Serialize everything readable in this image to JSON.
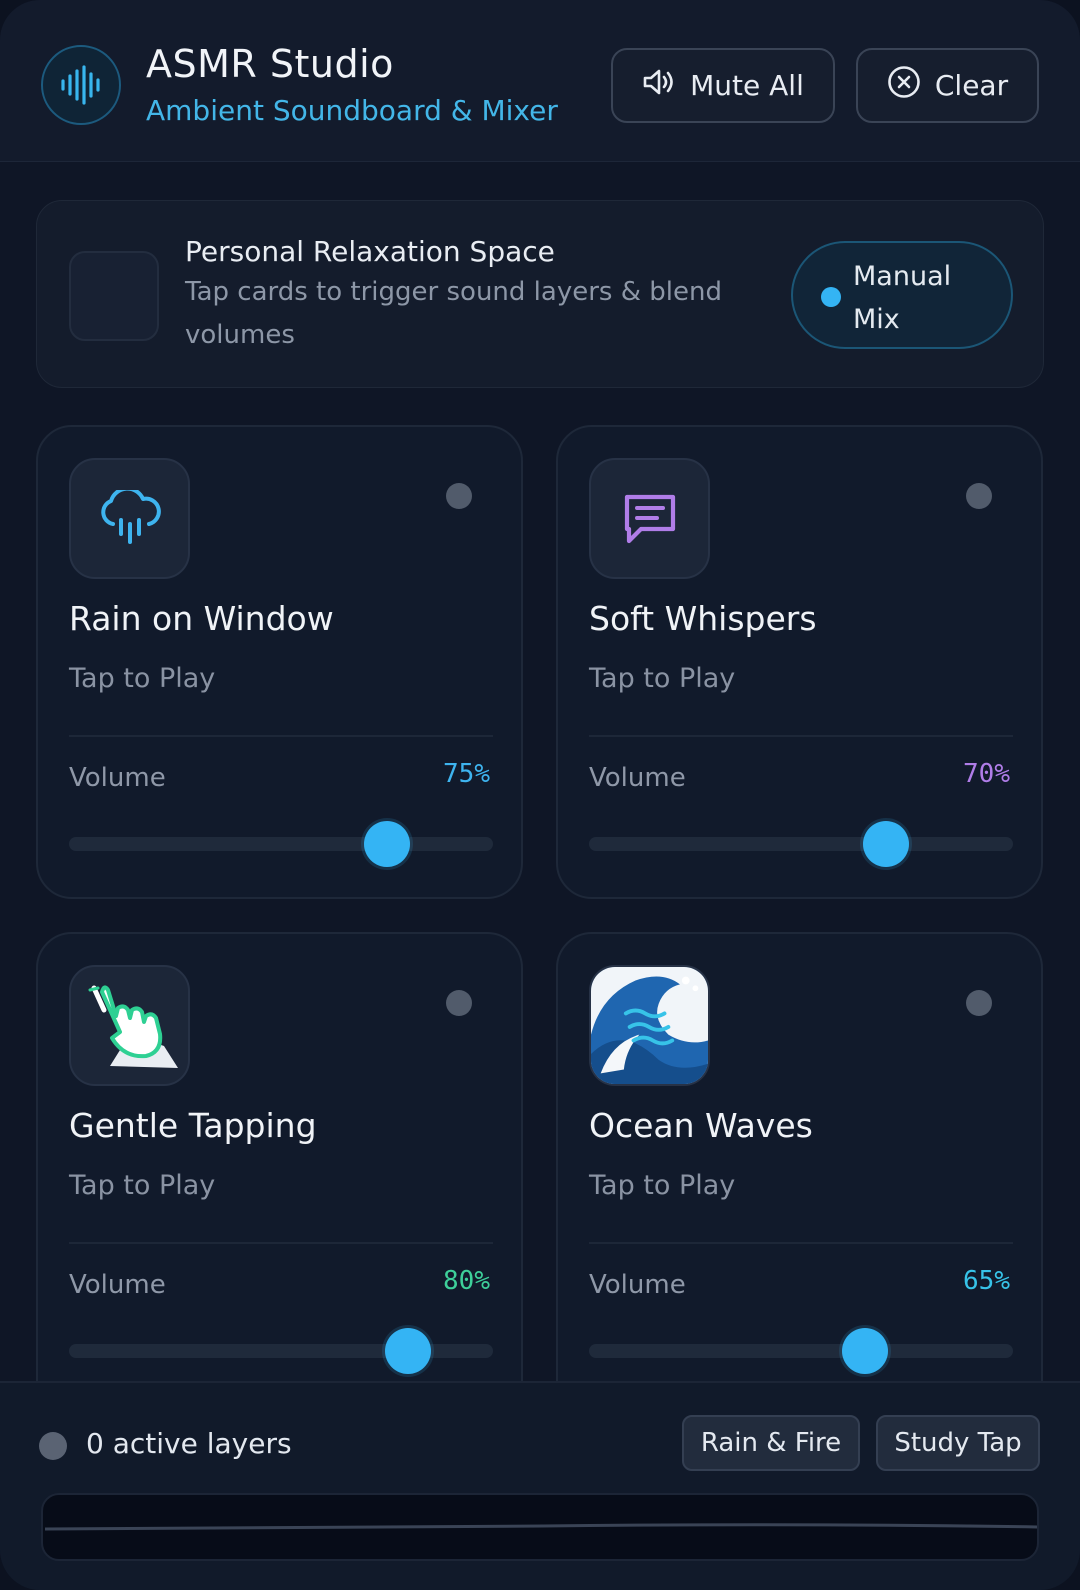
{
  "header": {
    "title": "ASMR Studio",
    "subtitle": "Ambient Soundboard & Mixer",
    "logo_icon": "sound-wave-icon",
    "mute_label": "Mute All",
    "mute_icon": "speaker-icon",
    "clear_label": "Clear",
    "clear_icon": "close-circle-icon"
  },
  "banner": {
    "title": "Personal Relaxation Space",
    "description": "Tap cards to trigger sound layers & blend volumes",
    "mode_label": "Manual Mix"
  },
  "cards": [
    {
      "title": "Rain on Window",
      "state": "Tap to Play",
      "volume_label": "Volume",
      "volume": "75%",
      "volume_fraction": 0.75,
      "accent": "#3eb4ef",
      "icon": "rain-cloud-icon"
    },
    {
      "title": "Soft Whispers",
      "state": "Tap to Play",
      "volume_label": "Volume",
      "volume": "70%",
      "volume_fraction": 0.7,
      "accent": "#b07de8",
      "icon": "chat-bubble-icon"
    },
    {
      "title": "Gentle Tapping",
      "state": "Tap to Play",
      "volume_label": "Volume",
      "volume": "80%",
      "volume_fraction": 0.8,
      "accent": "#3ecf9a",
      "icon": "tapping-hand-icon"
    },
    {
      "title": "Ocean Waves",
      "state": "Tap to Play",
      "volume_label": "Volume",
      "volume": "65%",
      "volume_fraction": 0.65,
      "accent": "#37c3e8",
      "icon": "ocean-wave-icon"
    }
  ],
  "footer": {
    "active_layers": "0 active layers",
    "presets": [
      "Rain & Fire",
      "Study Tap"
    ]
  },
  "colors": {
    "accent": "#34b4f4",
    "background": "#0f1626"
  }
}
